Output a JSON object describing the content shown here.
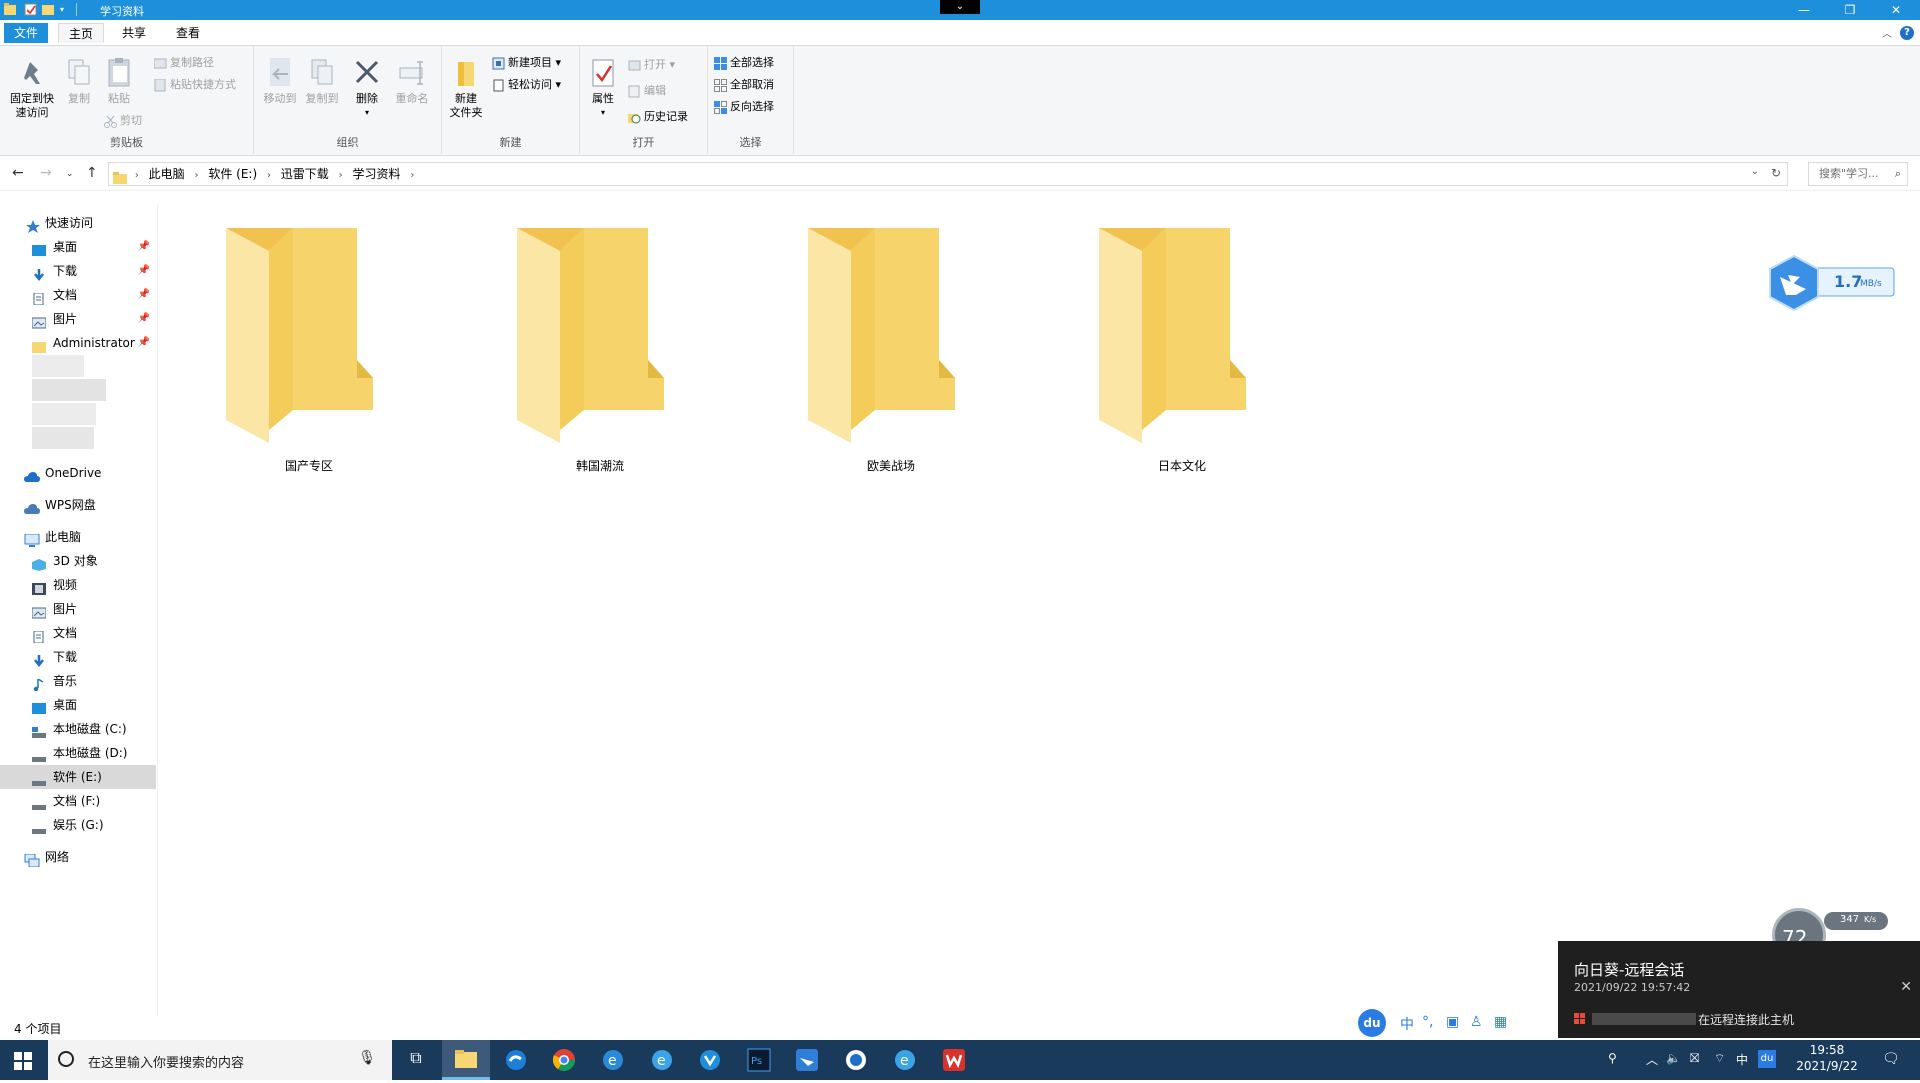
{
  "window": {
    "title": "学习资料",
    "controls": {
      "minimize": "—",
      "maximize": "❐",
      "close": "✕"
    }
  },
  "tabs": {
    "file": "文件",
    "home": "主页",
    "share": "共享",
    "view": "查看",
    "help": "?"
  },
  "ribbon": {
    "clipboard": {
      "label": "剪贴板",
      "pin": "固定到快\n速访问",
      "copy": "复制",
      "paste": "粘贴",
      "copy_path": "复制路径",
      "paste_shortcut": "粘贴快捷方式",
      "cut": "剪切"
    },
    "organize": {
      "label": "组织",
      "move_to": "移动到",
      "copy_to": "复制到",
      "delete": "删除",
      "rename": "重命名"
    },
    "new": {
      "label": "新建",
      "new_folder": "新建\n文件夹",
      "new_item": "新建项目 ▾",
      "easy_access": "轻松访问 ▾"
    },
    "open": {
      "label": "打开",
      "properties": "属性",
      "open": "打开 ▾",
      "edit": "编辑",
      "history": "历史记录"
    },
    "select": {
      "label": "选择",
      "select_all": "全部选择",
      "select_none": "全部取消",
      "invert": "反向选择"
    }
  },
  "address": {
    "crumbs": [
      "此电脑",
      "软件 (E:)",
      "迅雷下载",
      "学习资料"
    ],
    "search_placeholder": "搜索\"学习..."
  },
  "nav": {
    "quick_access": "快速访问",
    "quick_items": [
      {
        "label": "桌面"
      },
      {
        "label": "下载"
      },
      {
        "label": "文档"
      },
      {
        "label": "图片"
      },
      {
        "label": "Administrator"
      }
    ],
    "onedrive": "OneDrive",
    "wps": "WPS网盘",
    "this_pc": "此电脑",
    "pc_items": [
      {
        "label": "3D 对象"
      },
      {
        "label": "视频"
      },
      {
        "label": "图片"
      },
      {
        "label": "文档"
      },
      {
        "label": "下载"
      },
      {
        "label": "音乐"
      },
      {
        "label": "桌面"
      },
      {
        "label": "本地磁盘 (C:)"
      },
      {
        "label": "本地磁盘 (D:)"
      },
      {
        "label": "软件 (E:)"
      },
      {
        "label": "文档 (F:)"
      },
      {
        "label": "娱乐 (G:)"
      }
    ],
    "network": "网络"
  },
  "folders": [
    {
      "name": "国产专区"
    },
    {
      "name": "韩国潮流"
    },
    {
      "name": "欧美战场"
    },
    {
      "name": "日本文化"
    }
  ],
  "status": {
    "item_count": "4 个项目"
  },
  "speed_widget": {
    "value": "1.7",
    "unit": "MB/s"
  },
  "gauge": {
    "value": "72",
    "rate": "347",
    "rate_unit": "K/s"
  },
  "ime": {
    "logo": "du",
    "lang": "中"
  },
  "notification": {
    "title": "向日葵-远程会话",
    "time": "2021/09/22 19:57:42",
    "message": "在远程连接此主机"
  },
  "taskbar": {
    "search_placeholder": "在这里输入你要搜索的内容",
    "clock_time": "19:58",
    "clock_date": "2021/9/22",
    "ime_lang": "中",
    "tray_du": "du"
  }
}
